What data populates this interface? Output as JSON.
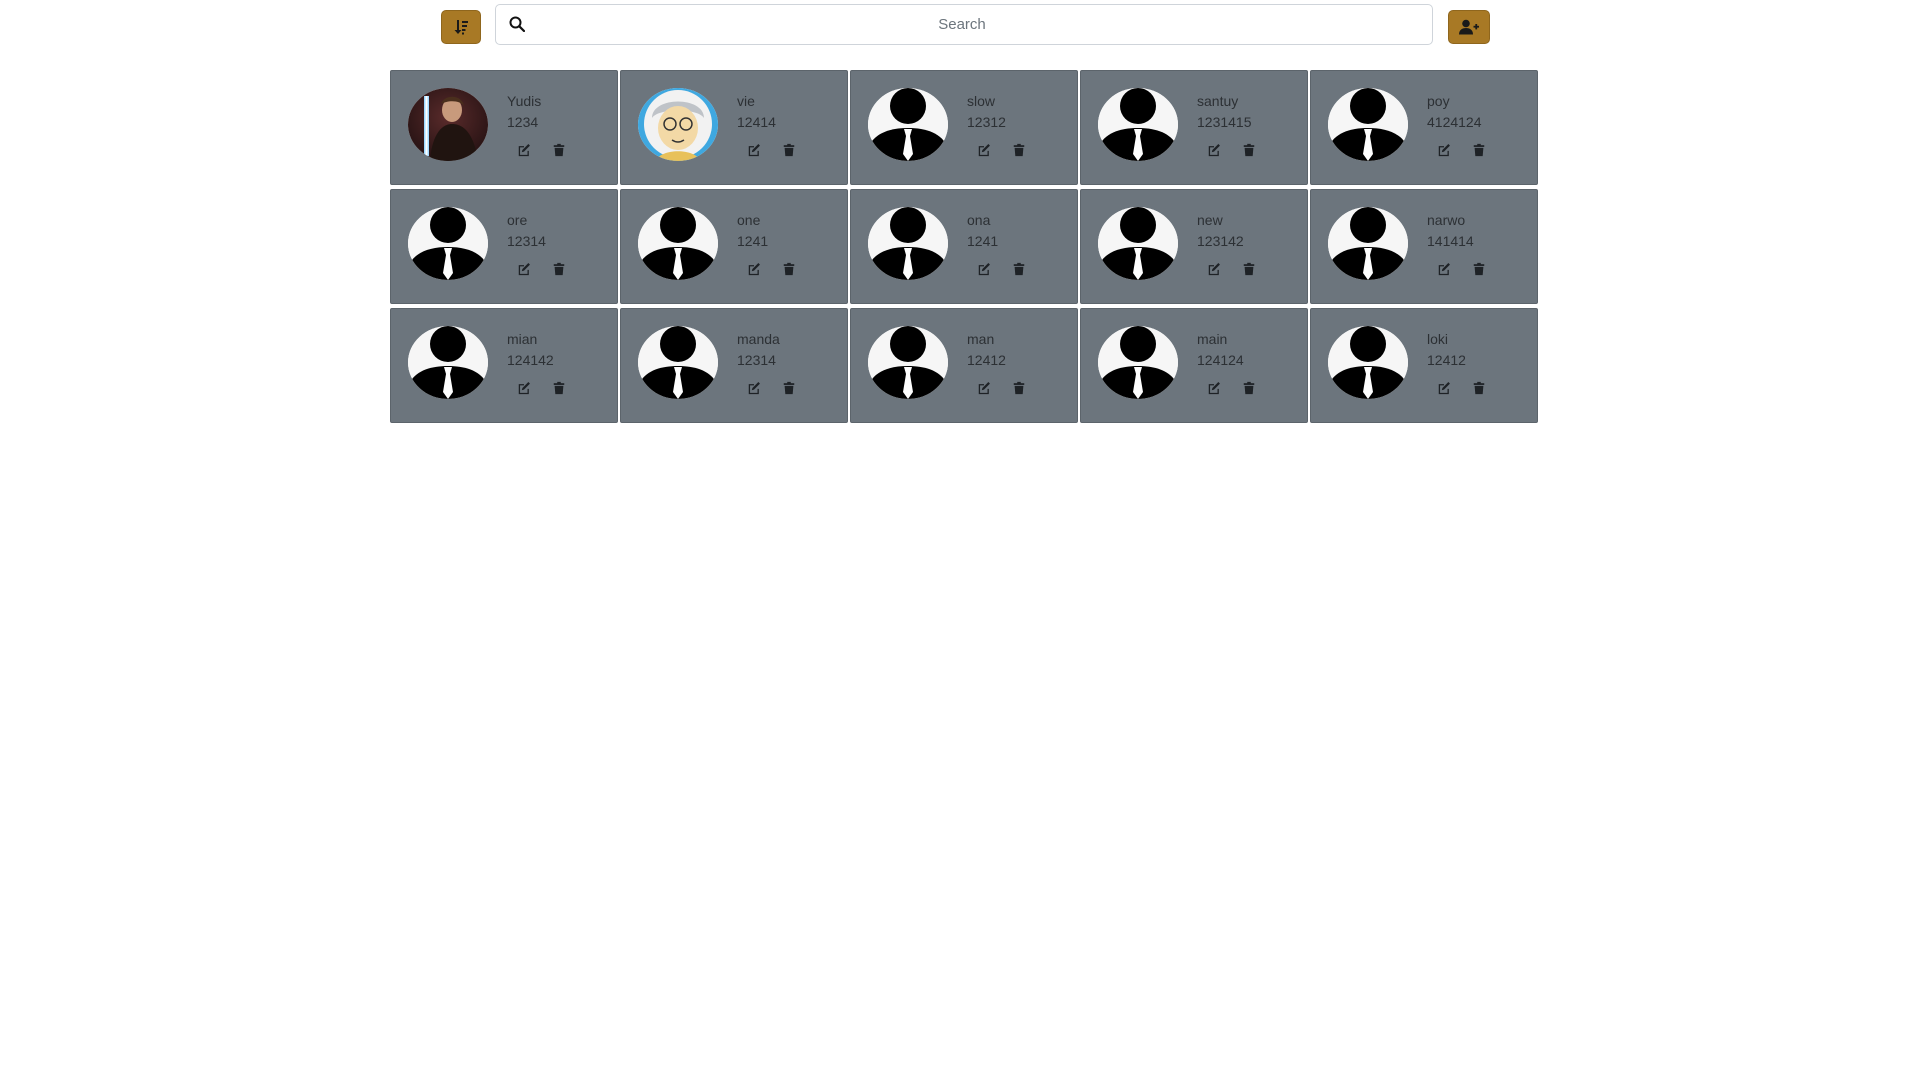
{
  "toolbar": {
    "sort_icon": "sort-amount-down-icon",
    "add_icon": "user-plus-icon",
    "accent_color": "#a87925"
  },
  "search": {
    "placeholder": "Search",
    "value": "",
    "icon": "search-icon"
  },
  "contacts": [
    {
      "name": "Yudis",
      "phone": "1234",
      "avatar": "photo-dark"
    },
    {
      "name": "vie",
      "phone": "12414",
      "avatar": "cartoon"
    },
    {
      "name": "slow",
      "phone": "12312",
      "avatar": "default"
    },
    {
      "name": "santuy",
      "phone": "1231415",
      "avatar": "default"
    },
    {
      "name": "poy",
      "phone": "4124124",
      "avatar": "default"
    },
    {
      "name": "ore",
      "phone": "12314",
      "avatar": "default"
    },
    {
      "name": "one",
      "phone": "1241",
      "avatar": "default"
    },
    {
      "name": "ona",
      "phone": "1241",
      "avatar": "default"
    },
    {
      "name": "new",
      "phone": "123142",
      "avatar": "default"
    },
    {
      "name": "narwo",
      "phone": "141414",
      "avatar": "default"
    },
    {
      "name": "mian",
      "phone": "124142",
      "avatar": "default"
    },
    {
      "name": "manda",
      "phone": "12314",
      "avatar": "default"
    },
    {
      "name": "man",
      "phone": "12412",
      "avatar": "default"
    },
    {
      "name": "main",
      "phone": "124124",
      "avatar": "default"
    },
    {
      "name": "loki",
      "phone": "12412",
      "avatar": "default"
    }
  ],
  "card": {
    "edit_icon": "edit-icon",
    "delete_icon": "trash-icon",
    "background": "#6c757d"
  }
}
